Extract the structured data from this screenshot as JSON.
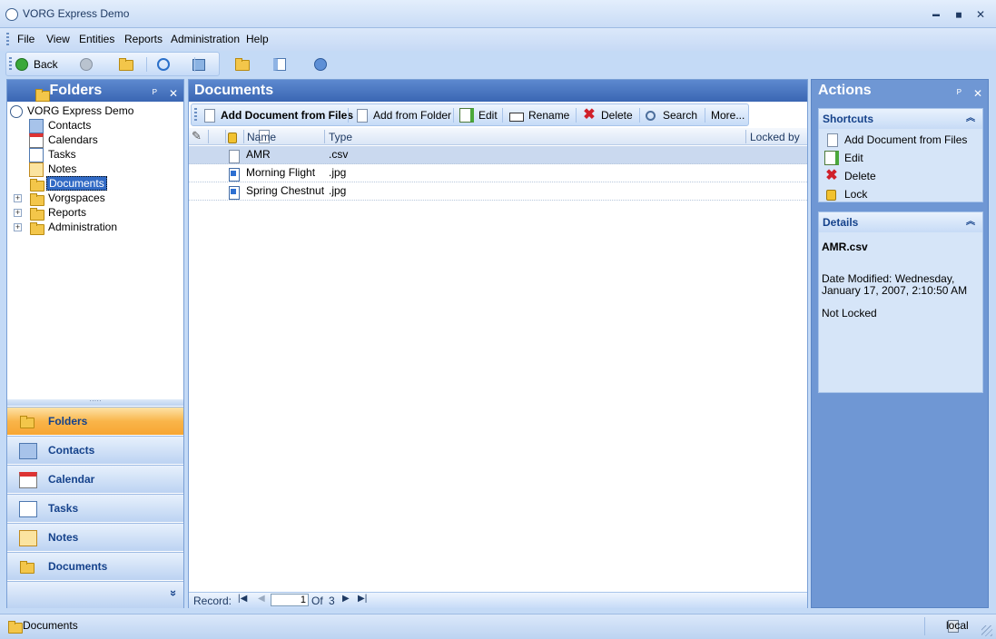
{
  "window": {
    "title": "VORG Express Demo",
    "controls": {
      "minimize": "▬",
      "maximize": "◼",
      "close": "✕"
    }
  },
  "menu": [
    "File",
    "View",
    "Entities",
    "Reports",
    "Administration",
    "Help"
  ],
  "toolbar": {
    "back_label": "Back"
  },
  "left_panel": {
    "title": "Folders",
    "pin": "ᴾ",
    "close": "✕",
    "tree": {
      "root": "VORG Express Demo",
      "items": [
        "Contacts",
        "Calendars",
        "Tasks",
        "Notes",
        "Documents",
        "Vorgspaces",
        "Reports",
        "Administration"
      ],
      "selected": "Documents"
    },
    "nav": [
      "Folders",
      "Contacts",
      "Calendar",
      "Tasks",
      "Notes",
      "Documents"
    ],
    "nav_active": "Folders",
    "nav_more": "»"
  },
  "center_panel": {
    "title": "Documents",
    "toolbar": {
      "add_files": "Add Document from Files",
      "add_folder": "Add from Folder",
      "edit": "Edit",
      "rename": "Rename",
      "delete": "Delete",
      "search": "Search",
      "more": "More..."
    },
    "columns": {
      "name": "Name",
      "type": "Type",
      "locked_by": "Locked by"
    },
    "rows": [
      {
        "name": "AMR",
        "type": ".csv",
        "icon": "document-icon"
      },
      {
        "name": "Morning Flight",
        "type": ".jpg",
        "icon": "image-file-icon"
      },
      {
        "name": "Spring Chestnut",
        "type": ".jpg",
        "icon": "image-file-icon"
      }
    ],
    "record": {
      "label": "Record:",
      "current": "1",
      "of_label": "Of",
      "total": "3"
    }
  },
  "right_panel": {
    "title": "Actions",
    "pin": "ᴾ",
    "close": "✕",
    "shortcuts": {
      "title": "Shortcuts",
      "items": [
        "Add Document from Files",
        "Edit",
        "Delete",
        "Lock"
      ]
    },
    "details": {
      "title": "Details",
      "filename": "AMR.csv",
      "modified": "Date Modified: Wednesday, January 17, 2007, 2:10:50 AM",
      "lock_status": "Not Locked"
    }
  },
  "status": {
    "left": "Documents",
    "right": "local"
  },
  "colors": {
    "accent": "#3a66b3",
    "nav_active": "#f9b54a",
    "selection": "#316ac5"
  }
}
